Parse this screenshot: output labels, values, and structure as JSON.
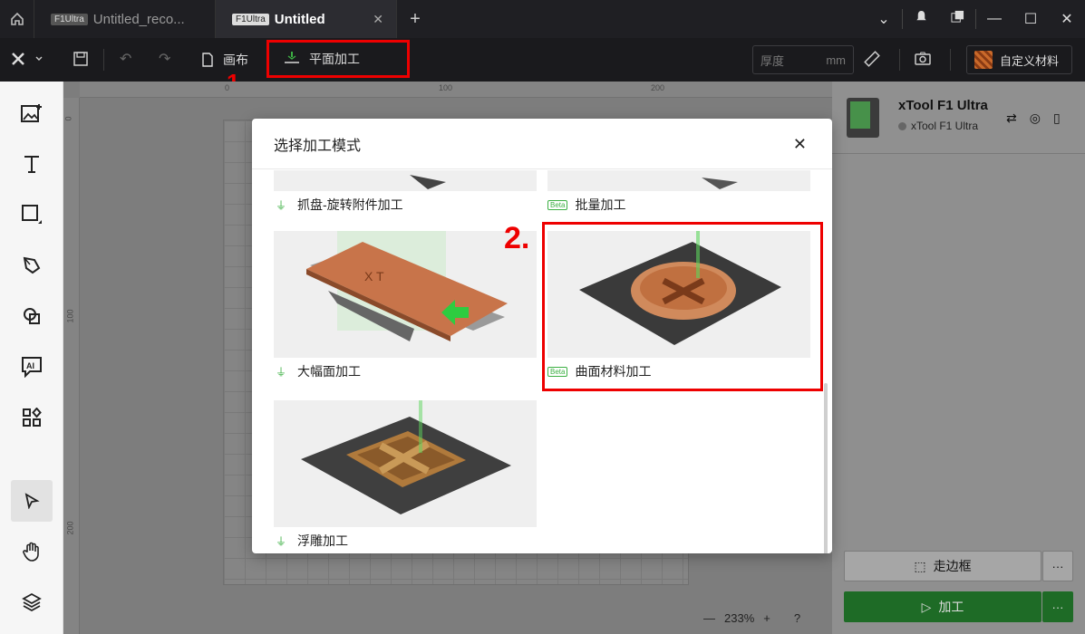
{
  "titlebar": {
    "tabs": [
      {
        "device": "F1Ultra",
        "name": "Untitled_reco..."
      },
      {
        "device": "F1Ultra",
        "name": "Untitled",
        "close": "✕"
      }
    ],
    "new_tab": "+"
  },
  "toolbar": {
    "canvas_label": "画布",
    "mode_label": "平面加工",
    "thickness_placeholder": "厚度",
    "thickness_unit": "mm",
    "material_label": "自定义材料"
  },
  "annotations": {
    "step1": "1.",
    "step2": "2."
  },
  "canvas": {
    "ruler_top": [
      "0",
      "100",
      "200"
    ],
    "ruler_left": [
      "0",
      "100",
      "200"
    ],
    "zoom": "233%"
  },
  "device_panel": {
    "name": "xTool F1 Ultra",
    "status": "xTool F1 Ultra",
    "frame_label": "走边框",
    "process_label": "加工",
    "more": "···"
  },
  "modal": {
    "title": "选择加工模式",
    "close": "✕",
    "modes": [
      {
        "label": "抓盘-旋转附件加工",
        "beta": false
      },
      {
        "label": "批量加工",
        "beta": true
      },
      {
        "label": "大幅面加工",
        "beta": false
      },
      {
        "label": "曲面材料加工",
        "beta": true
      },
      {
        "label": "浮雕加工",
        "beta": false
      }
    ],
    "beta_badge": "Beta"
  },
  "colors": {
    "accent_green": "#3cb043",
    "highlight_red": "#e00000"
  }
}
